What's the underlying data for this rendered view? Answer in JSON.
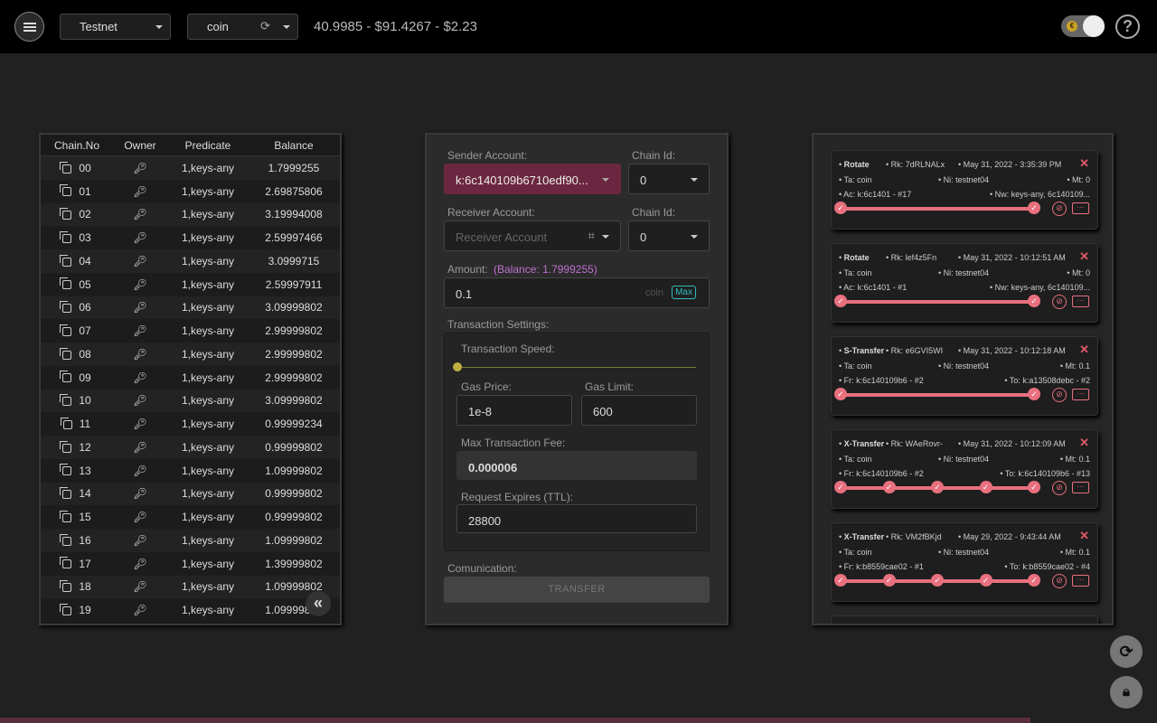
{
  "topbar": {
    "network": "Testnet",
    "token": "coin",
    "prices": "40.9985 - $91.4267 - $2.23"
  },
  "chains": {
    "headers": {
      "chain": "Chain.No",
      "owner": "Owner",
      "predicate": "Predicate",
      "balance": "Balance"
    },
    "rows": [
      {
        "no": "00",
        "predicate": "1,keys-any",
        "balance": "1.7999255"
      },
      {
        "no": "01",
        "predicate": "1,keys-any",
        "balance": "2.69875806"
      },
      {
        "no": "02",
        "predicate": "1,keys-any",
        "balance": "3.19994008"
      },
      {
        "no": "03",
        "predicate": "1,keys-any",
        "balance": "2.59997466"
      },
      {
        "no": "04",
        "predicate": "1,keys-any",
        "balance": "3.0999715"
      },
      {
        "no": "05",
        "predicate": "1,keys-any",
        "balance": "2.59997911"
      },
      {
        "no": "06",
        "predicate": "1,keys-any",
        "balance": "3.09999802"
      },
      {
        "no": "07",
        "predicate": "1,keys-any",
        "balance": "2.99999802"
      },
      {
        "no": "08",
        "predicate": "1,keys-any",
        "balance": "2.99999802"
      },
      {
        "no": "09",
        "predicate": "1,keys-any",
        "balance": "2.99999802"
      },
      {
        "no": "10",
        "predicate": "1,keys-any",
        "balance": "3.09999802"
      },
      {
        "no": "11",
        "predicate": "1,keys-any",
        "balance": "0.99999234"
      },
      {
        "no": "12",
        "predicate": "1,keys-any",
        "balance": "0.99999802"
      },
      {
        "no": "13",
        "predicate": "1,keys-any",
        "balance": "1.09999802"
      },
      {
        "no": "14",
        "predicate": "1,keys-any",
        "balance": "0.99999802"
      },
      {
        "no": "15",
        "predicate": "1,keys-any",
        "balance": "0.99999802"
      },
      {
        "no": "16",
        "predicate": "1,keys-any",
        "balance": "1.09999802"
      },
      {
        "no": "17",
        "predicate": "1,keys-any",
        "balance": "1.39999802"
      },
      {
        "no": "18",
        "predicate": "1,keys-any",
        "balance": "1.09999802"
      },
      {
        "no": "19",
        "predicate": "1,keys-any",
        "balance": "1.09999802"
      }
    ]
  },
  "form": {
    "sender_label": "Sender Account:",
    "sender_value": "k:6c140109b6710edf90...",
    "chain_id_label": "Chain Id:",
    "sender_chain": "0",
    "receiver_label": "Receiver Account:",
    "receiver_placeholder": "Receiver Account",
    "receiver_chain": "0",
    "amount_label": "Amount:",
    "amount_balance": "(Balance: 1.7999255)",
    "amount_value": "0.1",
    "amount_unit": "coin",
    "max_label": "Max",
    "settings_label": "Transaction Settings:",
    "speed_label": "Transaction Speed:",
    "speed_level": 0,
    "gas_price_label": "Gas Price:",
    "gas_price": "1e-8",
    "gas_limit_label": "Gas Limit:",
    "gas_limit": "600",
    "max_fee_label": "Max Transaction Fee:",
    "max_fee": "0.000006",
    "ttl_label": "Request Expires (TTL):",
    "ttl": "28800",
    "communication_label": "Comunication:",
    "transfer_label": "TRANSFER"
  },
  "history": [
    {
      "type": "Rotate",
      "rk": "Rk: 7dRLNALx",
      "date": "May 31, 2022 - 3:35:39 PM",
      "ta": "Ta: coin",
      "ni": "Ni: testnet04",
      "mt": "Mt: 0",
      "left": "Ac: k:6c1401 - #17",
      "right": "Nw: keys-any, 6c140109..."
    },
    {
      "type": "Rotate",
      "rk": "Rk: lef4z5Fn",
      "date": "May 31, 2022 - 10:12:51 AM",
      "ta": "Ta: coin",
      "ni": "Ni: testnet04",
      "mt": "Mt: 0",
      "left": "Ac: k:6c1401 - #1",
      "right": "Nw: keys-any, 6c140109..."
    },
    {
      "type": "S-Transfer",
      "rk": "Rk: e6GVI5WI",
      "date": "May 31, 2022 - 10:12:18 AM",
      "ta": "Ta: coin",
      "ni": "Ni: testnet04",
      "mt": "Mt: 0.1",
      "left": "Fr: k:6c140109b6 - #2",
      "right": "To: k:a13508debc - #2"
    },
    {
      "type": "X-Transfer",
      "rk": "Rk: WAeRovr-",
      "date": "May 31, 2022 - 10:12:09 AM",
      "ta": "Ta: coin",
      "ni": "Ni: testnet04",
      "mt": "Mt: 0.1",
      "left": "Fr: k:6c140109b6 - #2",
      "right": "To: k:6c140109b6 - #13"
    },
    {
      "type": "X-Transfer",
      "rk": "Rk: VM2fBKjd",
      "date": "May 29, 2022 - 9:43:44 AM",
      "ta": "Ta: coin",
      "ni": "Ni: testnet04",
      "mt": "Mt: 0.1",
      "left": "Fr: k:b8559cae02 - #1",
      "right": "To: k:b8559cae02 - #4"
    }
  ],
  "icons": {
    "check": "✓",
    "close": "✕",
    "copy": "copy-icon",
    "key": "key-icon",
    "collapse": "«",
    "refresh": "⟳",
    "lock": "lock-icon",
    "compass": "compass-icon",
    "tag": "tag-icon"
  }
}
